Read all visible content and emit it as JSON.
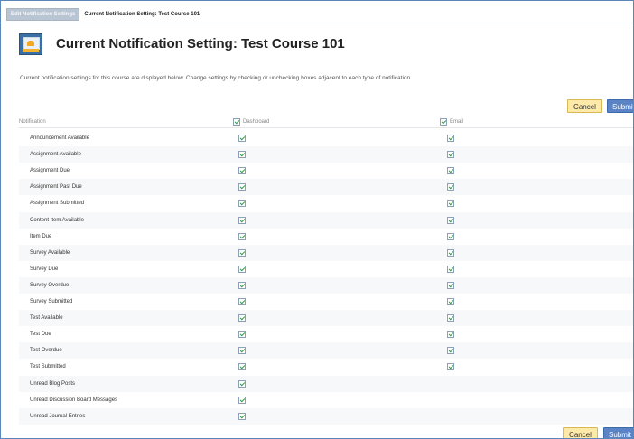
{
  "breadcrumb": {
    "item1": "Edit Notification Settings",
    "item2": "Current Notification Setting: Test Course 101"
  },
  "page": {
    "title": "Current Notification Setting: Test Course 101",
    "description": "Current notification settings for this course are displayed below. Change settings by checking or unchecking boxes adjacent to each type of notification."
  },
  "buttons": {
    "cancel": "Cancel",
    "submit": "Submit"
  },
  "table": {
    "headers": {
      "notification": "Notification",
      "dashboard": "Dashboard",
      "email": "Email"
    },
    "rows": [
      {
        "label": "Announcement Available",
        "dashboard": true,
        "email": true
      },
      {
        "label": "Assignment Available",
        "dashboard": true,
        "email": true
      },
      {
        "label": "Assignment Due",
        "dashboard": true,
        "email": true
      },
      {
        "label": "Assignment Past Due",
        "dashboard": true,
        "email": true
      },
      {
        "label": "Assignment Submitted",
        "dashboard": true,
        "email": true
      },
      {
        "label": "Content Item Available",
        "dashboard": true,
        "email": true
      },
      {
        "label": "Item Due",
        "dashboard": true,
        "email": true
      },
      {
        "label": "Survey Available",
        "dashboard": true,
        "email": true
      },
      {
        "label": "Survey Due",
        "dashboard": true,
        "email": true
      },
      {
        "label": "Survey Overdue",
        "dashboard": true,
        "email": true
      },
      {
        "label": "Survey Submitted",
        "dashboard": true,
        "email": true
      },
      {
        "label": "Test Available",
        "dashboard": true,
        "email": true
      },
      {
        "label": "Test Due",
        "dashboard": true,
        "email": true
      },
      {
        "label": "Test Overdue",
        "dashboard": true,
        "email": true
      },
      {
        "label": "Test Submitted",
        "dashboard": true,
        "email": true
      },
      {
        "label": "Unread Blog Posts",
        "dashboard": true,
        "email": false
      },
      {
        "label": "Unread Discussion Board Messages",
        "dashboard": true,
        "email": false
      },
      {
        "label": "Unread Journal Entries",
        "dashboard": true,
        "email": false
      }
    ]
  },
  "icons": {
    "title": "course-notification-icon",
    "checkbox": "checkbox-checked-icon"
  },
  "colors": {
    "frame_border": "#5b86b8",
    "submit": "#5a84c6",
    "cancel": "#fde9a8",
    "check": "#2f9a45"
  }
}
